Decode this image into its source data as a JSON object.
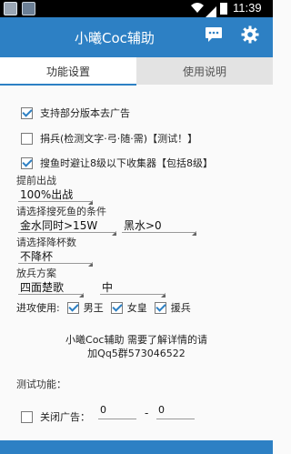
{
  "status": {
    "time": "11:39"
  },
  "app": {
    "title": "小曦Coc辅助"
  },
  "icons": {
    "chat": "chat-bubble-icon",
    "settings": "gear-icon"
  },
  "tabs": [
    {
      "label": "功能设置",
      "active": true
    },
    {
      "label": "使用说明",
      "active": false
    }
  ],
  "options": [
    {
      "label": "支持部分版本去广告",
      "checked": true
    },
    {
      "label": "捐兵(检测文字·弓·随·需)【测试！】",
      "checked": false
    },
    {
      "label": "搜鱼时避让8级以下收集器【包括8级】",
      "checked": true
    }
  ],
  "early_battle": {
    "label": "提前出战",
    "value": "100%出战"
  },
  "search_cond": {
    "label": "请选择搜死鱼的条件",
    "value1": "金水同时>15W",
    "value2": "黑水>0"
  },
  "cup": {
    "label": "请选择降杯数",
    "value": "不降杯"
  },
  "troops": {
    "label": "放兵方案",
    "value1": "四面楚歌",
    "value2": "中"
  },
  "attack": {
    "label": "进攻使用:",
    "items": [
      {
        "label": "男王",
        "checked": true
      },
      {
        "label": "女皇",
        "checked": true
      },
      {
        "label": "援兵",
        "checked": true
      }
    ]
  },
  "notice": {
    "line1": "小曦Coc辅助 需要了解详情的请",
    "line2": "加Qq5群573046522"
  },
  "test": {
    "label": "测试功能：",
    "ad_label": "关闭广告：",
    "ad_checked": false,
    "value1": "0",
    "dash": "-",
    "value2": "0"
  },
  "colors": {
    "primary": "#2d80c4",
    "status_bar": "#000000",
    "background": "#fafafa"
  }
}
